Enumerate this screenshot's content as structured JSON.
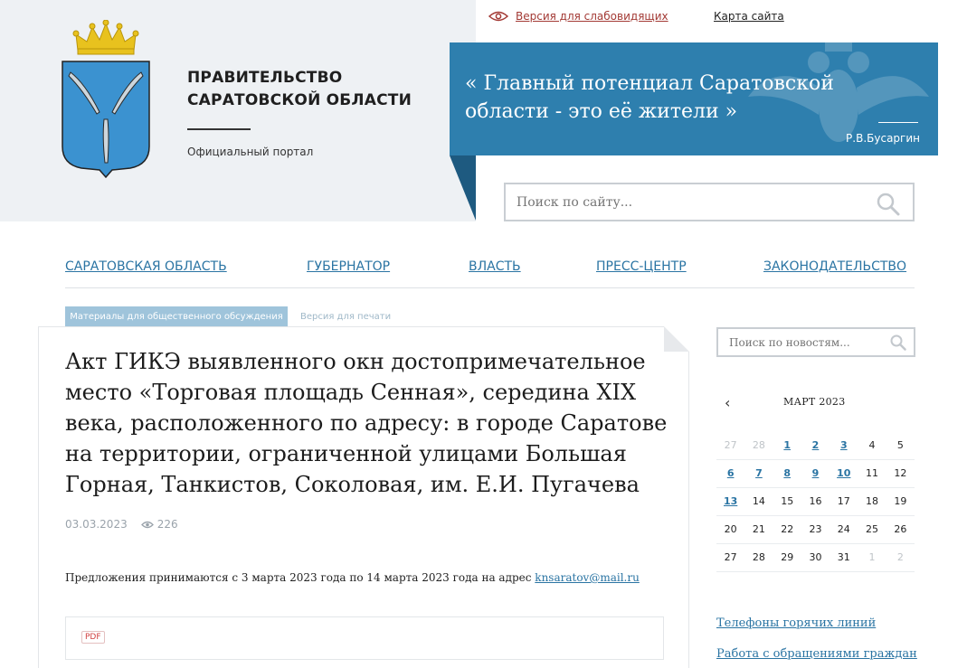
{
  "header": {
    "gov_title_line1": "ПРАВИТЕЛЬСТВО",
    "gov_title_line2": "САРАТОВСКОЙ ОБЛАСТИ",
    "gov_subtitle": "Официальный портал",
    "vision_link": "Версия для слабовидящих",
    "sitemap_link": "Карта сайта",
    "quote": "« Главный потенциал Саратовской области - это её жители »",
    "quote_author": "Р.В.Бусаргин",
    "search_placeholder": "Поиск по сайту..."
  },
  "nav": {
    "items": [
      {
        "label": "САРАТОВСКАЯ ОБЛАСТЬ"
      },
      {
        "label": "ГУБЕРНАТОР"
      },
      {
        "label": "ВЛАСТЬ"
      },
      {
        "label": "ПРЕСС-ЦЕНТР"
      },
      {
        "label": "ЗАКОНОДАТЕЛЬСТВО"
      }
    ]
  },
  "tabs": {
    "active": "Материалы для общественного обсуждения",
    "print": "Версия для печати"
  },
  "article": {
    "title": "Акт ГИКЭ выявленного окн достопримечательное место «Торговая площадь Сенная», середина XIX века, расположенного по адресу: в городе Саратове на территории, ограниченной улицами Большая Горная, Танкистов, Соколовая, им. Е.И. Пугачева",
    "date": "03.03.2023",
    "views": "226",
    "notice_text": "Предложения принимаются с 3 марта 2023 года по 14 марта 2023 года на адрес ",
    "notice_email": "knsaratov@mail.ru",
    "attachment_badge": "PDF"
  },
  "sidebar": {
    "news_search_placeholder": "Поиск по новостям...",
    "calendar": {
      "prev": "‹",
      "month": "МАРТ 2023",
      "weeks": [
        [
          {
            "d": "27",
            "s": "muted"
          },
          {
            "d": "28",
            "s": "muted"
          },
          {
            "d": "1",
            "s": "link"
          },
          {
            "d": "2",
            "s": "link"
          },
          {
            "d": "3",
            "s": "link"
          },
          {
            "d": "4",
            "s": ""
          },
          {
            "d": "5",
            "s": ""
          }
        ],
        [
          {
            "d": "6",
            "s": "link"
          },
          {
            "d": "7",
            "s": "link"
          },
          {
            "d": "8",
            "s": "link"
          },
          {
            "d": "9",
            "s": "link"
          },
          {
            "d": "10",
            "s": "link"
          },
          {
            "d": "11",
            "s": ""
          },
          {
            "d": "12",
            "s": ""
          }
        ],
        [
          {
            "d": "13",
            "s": "link"
          },
          {
            "d": "14",
            "s": ""
          },
          {
            "d": "15",
            "s": ""
          },
          {
            "d": "16",
            "s": ""
          },
          {
            "d": "17",
            "s": ""
          },
          {
            "d": "18",
            "s": ""
          },
          {
            "d": "19",
            "s": ""
          }
        ],
        [
          {
            "d": "20",
            "s": ""
          },
          {
            "d": "21",
            "s": ""
          },
          {
            "d": "22",
            "s": ""
          },
          {
            "d": "23",
            "s": ""
          },
          {
            "d": "24",
            "s": ""
          },
          {
            "d": "25",
            "s": ""
          },
          {
            "d": "26",
            "s": ""
          }
        ],
        [
          {
            "d": "27",
            "s": ""
          },
          {
            "d": "28",
            "s": ""
          },
          {
            "d": "29",
            "s": ""
          },
          {
            "d": "30",
            "s": ""
          },
          {
            "d": "31",
            "s": ""
          },
          {
            "d": "1",
            "s": "muted"
          },
          {
            "d": "2",
            "s": "muted"
          }
        ]
      ]
    },
    "links": [
      {
        "label": "Телефоны горячих линий"
      },
      {
        "label": "Работа с обращениями граждан"
      }
    ]
  },
  "colors": {
    "accent_blue": "#2e7fae",
    "link_blue": "#2a74a3",
    "vision_red": "#a33a35",
    "tab_blue": "#9fc4db"
  }
}
